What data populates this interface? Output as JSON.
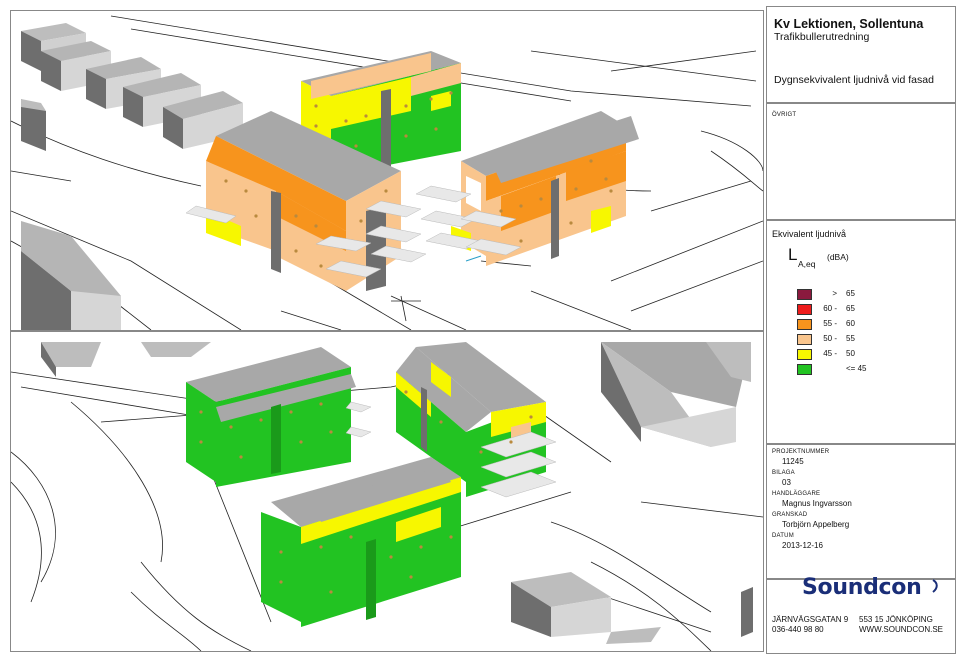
{
  "title": {
    "project": "Kv Lektionen, Sollentuna",
    "report": "Trafikbullerutredning",
    "description": "Dygnsekvivalent ljudnivå vid fasad"
  },
  "other": {
    "label": "ÖVRIGT"
  },
  "legend": {
    "heading": "Ekvivalent ljudnivå",
    "symbol": "L",
    "subscript": "A,eq",
    "unit": "(dBA)",
    "ranges": [
      {
        "low": ">",
        "high": "65",
        "color": "#8b1a3e"
      },
      {
        "low": "60 -",
        "high": "65",
        "color": "#ee1c1c"
      },
      {
        "low": "55 -",
        "high": "60",
        "color": "#f7941d"
      },
      {
        "low": "50 -",
        "high": "55",
        "color": "#f9c58d"
      },
      {
        "low": "45 -",
        "high": "50",
        "color": "#f7f700"
      },
      {
        "low": "",
        "high": "<= 45",
        "color": "#22c322"
      }
    ]
  },
  "project_info": {
    "project_number_label": "PROJEKTNUMMER",
    "project_number": "11245",
    "attachment_label": "BILAGA",
    "attachment": "03",
    "handler_label": "HANDLÄGGARE",
    "handler": "Magnus Ingvarsson",
    "reviewer_label": "GRANSKAD",
    "reviewer": "Torbjörn Appelberg",
    "date_label": "DATUM",
    "date": "2013-12-16"
  },
  "company": {
    "logo_text": "Soundcon",
    "street": "JÄRNVÄGSGATAN 9",
    "city": "553 15 JÖNKÖPING",
    "phone": "036-440 98 80",
    "web": "WWW.SOUNDCON.SE"
  },
  "colors": {
    "orange": "#f7941d",
    "light_orange": "#f9c58d",
    "yellow": "#f7f700",
    "green": "#22c322",
    "roof": "#a8a8a8",
    "wall_dark": "#6e6e6e",
    "balcony": "#e6e6e6"
  }
}
